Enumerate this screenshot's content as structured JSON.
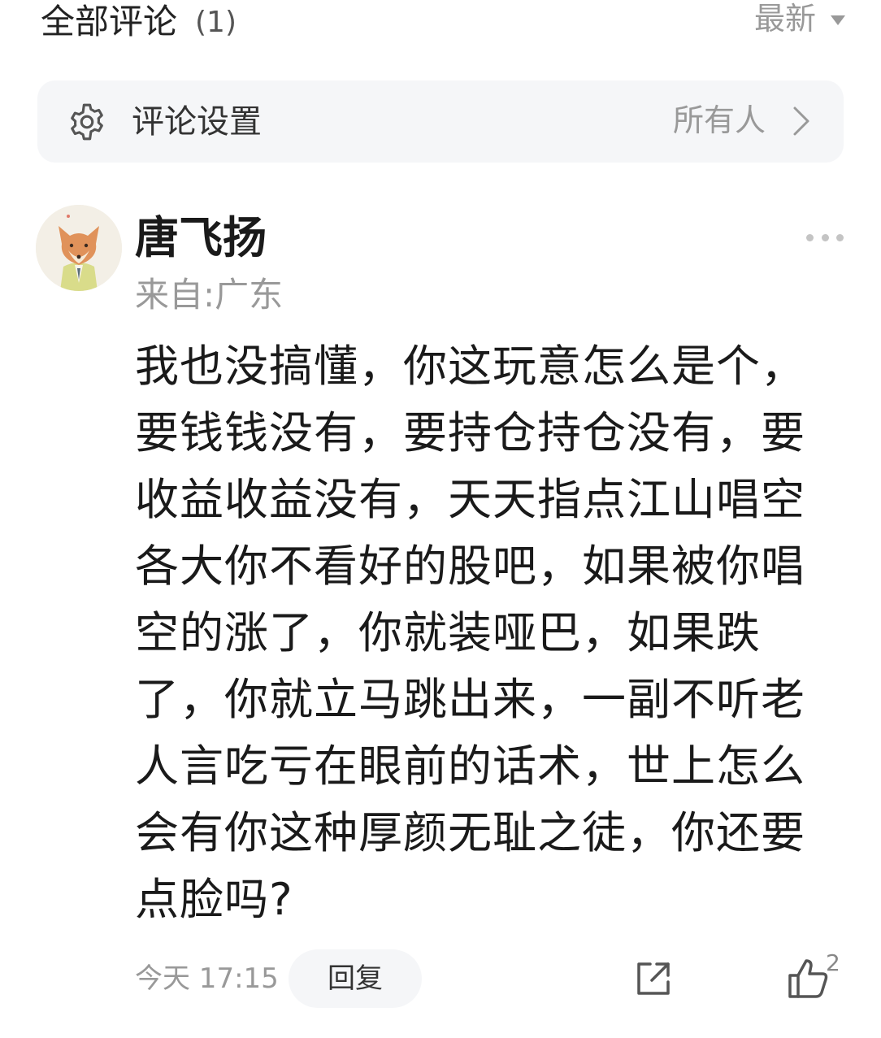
{
  "header": {
    "title": "全部评论",
    "count": "(1)",
    "sort_label": "最新"
  },
  "settings": {
    "label": "评论设置",
    "value": "所有人"
  },
  "comment": {
    "username": "唐飞扬",
    "location": "来自:广东",
    "text": "我也没搞懂，你这玩意怎么是个，要钱钱没有，要持仓持仓没有，要收益收益没有，天天指点江山唱空各大你不看好的股吧，如果被你唱空的涨了，你就装哑巴，如果跌了，你就立马跳出来，一副不听老人言吃亏在眼前的话术，世上怎么会有你这种厚颜无耻之徒，你还要点脸吗?",
    "timestamp": "今天 17:15",
    "reply_label": "回复",
    "like_count": "2"
  },
  "icons": {
    "settings": "gear-icon",
    "chevron": "chevron-right-icon",
    "sort": "caret-down-icon",
    "more": "more-dots-icon",
    "share": "share-icon",
    "like": "thumbs-up-icon",
    "avatar": "fox-avatar"
  },
  "colors": {
    "text_primary": "#1a1a1a",
    "text_secondary": "#999999",
    "panel_bg": "#f5f6f8",
    "icon_gray": "#555555"
  }
}
